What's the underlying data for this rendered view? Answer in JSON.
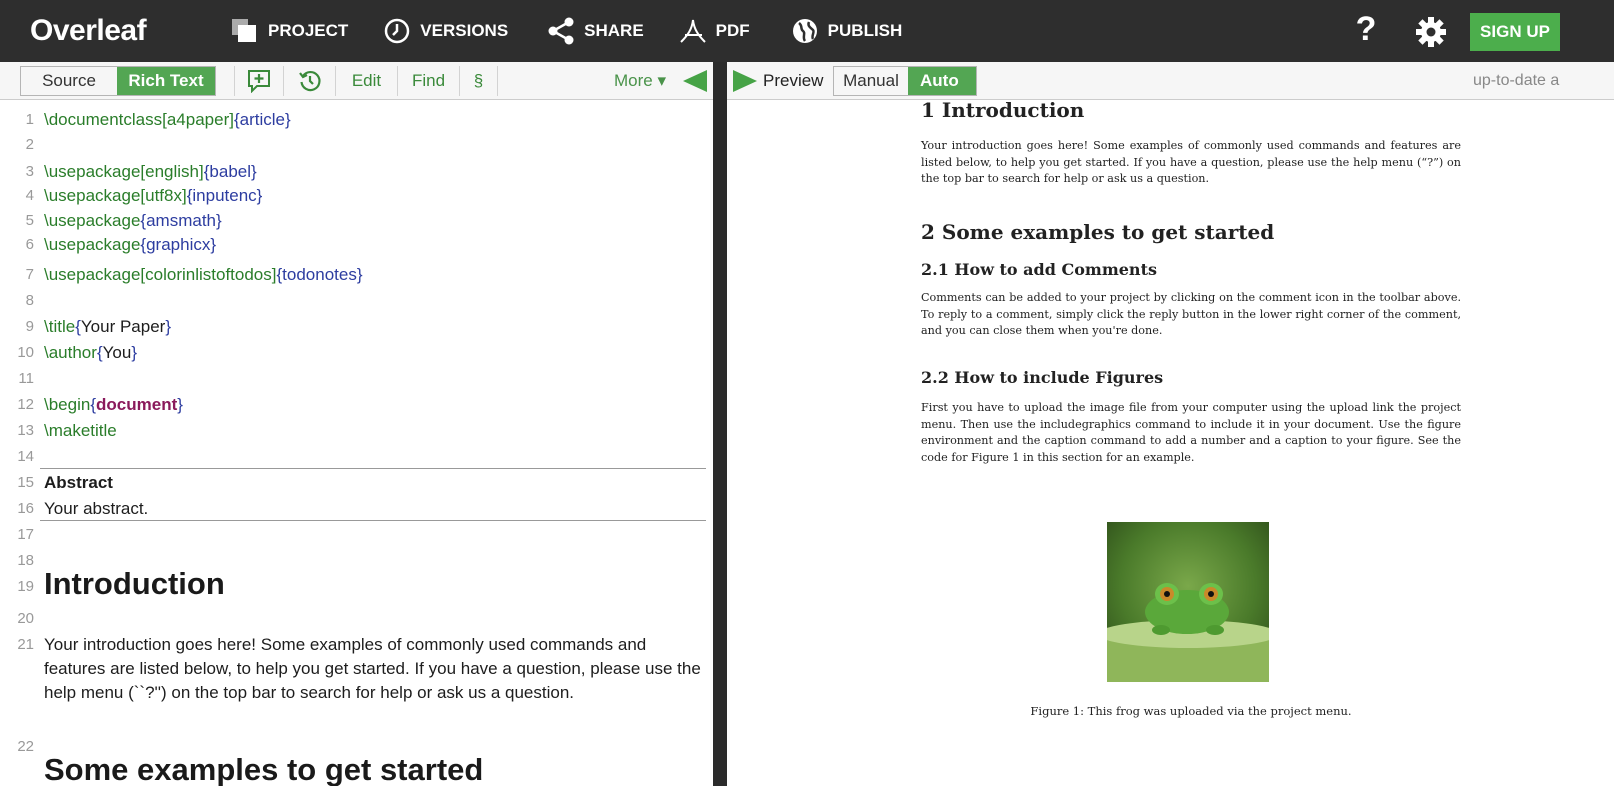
{
  "app": {
    "logo": "Overleaf"
  },
  "topnav": {
    "items": [
      {
        "label": "PROJECT",
        "icon": "project-icon"
      },
      {
        "label": "VERSIONS",
        "icon": "clock-icon"
      },
      {
        "label": "SHARE",
        "icon": "share-icon"
      },
      {
        "label": "PDF",
        "icon": "pdf-icon"
      },
      {
        "label": "PUBLISH",
        "icon": "globe-icon"
      }
    ],
    "help": "?",
    "signup": "SIGN UP"
  },
  "editor_toolbar": {
    "source": "Source",
    "rich_text": "Rich Text",
    "edit": "Edit",
    "find": "Find",
    "section": "§",
    "more": "More ▾"
  },
  "preview_toolbar": {
    "preview": "Preview",
    "manual": "Manual",
    "auto": "Auto",
    "status": "up-to-date a"
  },
  "editor": {
    "line_numbers": [
      "1",
      "2",
      "3",
      "4",
      "5",
      "6",
      "7",
      "8",
      "9",
      "10",
      "11",
      "12",
      "13",
      "14",
      "15",
      "16",
      "17",
      "18",
      "19",
      "20",
      "21",
      "22"
    ],
    "l1": {
      "cmd": "\\documentclass",
      "opt": "[a4paper]",
      "arg": "{article}"
    },
    "l3": {
      "cmd": "\\usepackage",
      "opt": "[english]",
      "arg": "{babel}"
    },
    "l4": {
      "cmd": "\\usepackage",
      "opt": "[utf8x]",
      "arg": "{inputenc}"
    },
    "l5": {
      "cmd": "\\usepackage",
      "arg": "{amsmath}"
    },
    "l6": {
      "cmd": "\\usepackage",
      "arg": "{graphicx}"
    },
    "l7": {
      "cmd": "\\usepackage",
      "opt": "[colorinlistoftodos]",
      "arg": "{todonotes}"
    },
    "l9": {
      "cmd": "\\title",
      "arg_open": "{",
      "arg_text": "Your Paper",
      "arg_close": "}"
    },
    "l10": {
      "cmd": "\\author",
      "arg_open": "{",
      "arg_text": "You",
      "arg_close": "}"
    },
    "l12": {
      "cmd": "\\begin",
      "arg_open": "{",
      "arg_text": "document",
      "arg_close": "}"
    },
    "l13": {
      "cmd": "\\maketitle"
    },
    "abstract_title": "Abstract",
    "abstract_text": "Your abstract.",
    "intro_heading": "Introduction",
    "intro_text": "Your introduction goes here! Some examples of commonly used commands and features are listed below, to help you get started. If you have a question, please use the help menu (``?'') on the top bar to search for help or ask us a question.",
    "next_heading": "Some examples to get started"
  },
  "pdf": {
    "sec1": "1   Introduction",
    "sec1_text": "Your introduction goes here! Some examples of commonly used commands and features are listed below, to help you get started. If you have a question, please use the help menu (“?”) on the top bar to search for help or ask us a question.",
    "sec2": "2   Some examples to get started",
    "sub21": "2.1   How to add Comments",
    "sub21_text": "Comments can be added to your project by clicking on the comment icon in the toolbar above. To reply to a comment, simply click the reply button in the lower right corner of the comment, and you can close them when you're done.",
    "sub22": "2.2   How to include Figures",
    "sub22_text": "First you have to upload the image file from your computer using the upload link the project menu. Then use the includegraphics command to include it in your document. Use the figure environment and the caption command to add a number and a caption to your figure. See the code for Figure 1 in this section for an example.",
    "caption": "Figure 1: This frog was uploaded via the project menu."
  },
  "colors": {
    "topbar": "#2e2e2e",
    "accent_green": "#53a653",
    "signup": "#4cae4c"
  }
}
